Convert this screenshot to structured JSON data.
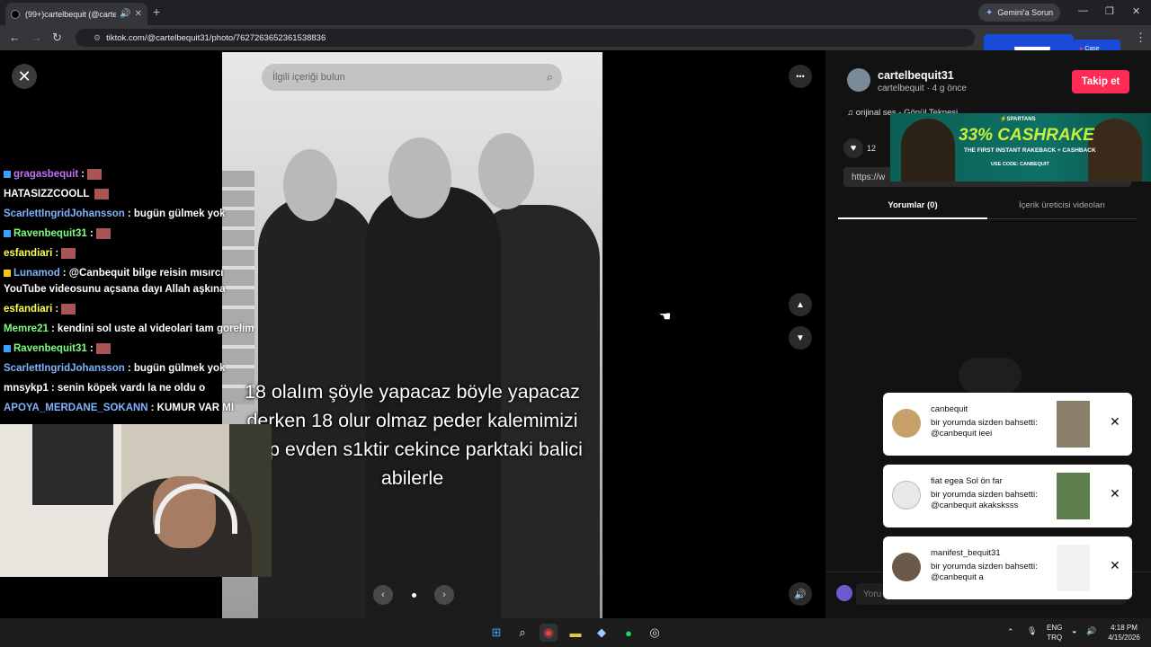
{
  "browser": {
    "tab_title": "(99+)cartelbequit (@carte",
    "tab_mute": "🔊",
    "tab_close": "✕",
    "new_tab": "+",
    "gemini_label": "Gemini'a Sorun",
    "window_minimize": "—",
    "window_restore": "❐",
    "window_close": "✕",
    "url": "tiktok.com/@cartelbequit31/photo/7627263652361538836",
    "ad_label": "Case"
  },
  "viewer": {
    "close": "✕",
    "search_placeholder": "İlgili içeriği bulun",
    "caption": "18 olalım şöyle yapacaz böyle yapacaz derken 18 olur olmaz peder kalemimizi kırıp evden s1ktir cekince parktaki balici abilerle",
    "more": "•••",
    "prev_photo": "‹",
    "next_photo": "›",
    "nav_up": "▲",
    "nav_down": "▼",
    "sound": "🔊"
  },
  "chat": [
    {
      "user": "gragasbequit",
      "color": "#c471ff",
      "text": "",
      "emote": true
    },
    {
      "user": "HATASIZZCOOLL",
      "color": "#ffffff",
      "text": "",
      "emote": true
    },
    {
      "user": "ScarlettIngridJohansson",
      "color": "#7fb3ff",
      "text": "bugün gülmek yok"
    },
    {
      "user": "Ravenbequit31",
      "color": "#7cff7c",
      "text": "",
      "emote": true
    },
    {
      "user": "esfandiari",
      "color": "#ffff55",
      "text": "",
      "emote": true
    },
    {
      "user": "Lunamod",
      "color": "#7fb3ff",
      "text": "@Canbequit bilge reisin mısırcı"
    },
    {
      "user": "",
      "color": "#ffffff",
      "text": "YouTube videosunu açsana dayı Allah aşkına"
    },
    {
      "user": "esfandiari",
      "color": "#ffff55",
      "text": "",
      "emote": true
    },
    {
      "user": "Memre21",
      "color": "#7cff7c",
      "text": "kendini sol uste al videolari tam gorelim"
    },
    {
      "user": "Ravenbequit31",
      "color": "#7cff7c",
      "text": "",
      "emote": true
    },
    {
      "user": "ScarlettIngridJohansson",
      "color": "#7fb3ff",
      "text": "bugün gülmek yok"
    },
    {
      "user": "mnsykp1",
      "color": "#ffffff",
      "text": "senin köpek vardı la ne oldu o"
    },
    {
      "user": "APOYA_MERDANE_SOKANN",
      "color": "#7fb3ff",
      "text": "KUMUR VAR MI"
    }
  ],
  "chat_sep": ":",
  "panel": {
    "username": "cartelbequit31",
    "subline": "cartelbequit · 4 g önce",
    "follow": "Takip et",
    "music": "♫  orijinal ses - Gönül Teknesi",
    "like_icon": "♥",
    "like_count": "12",
    "link": "https://w",
    "tab_comments": "Yorumlar (0)",
    "tab_creator": "İçerik üreticisi videoları",
    "comment_placeholder": "Yoru"
  },
  "banner": {
    "brand": "⚡SPARTANS",
    "headline": "33% CASHRAKE",
    "subline": "THE FIRST INSTANT RAKEBACK + CASHBACK",
    "code": "USE CODE: CANBEQUIT"
  },
  "toasts": [
    {
      "user": "canbequit",
      "msg": "bir yorumda sizden bahsetti: @canbequit ieei",
      "close": "✕"
    },
    {
      "user": "fiat egea Sol ön far",
      "msg": "bir yorumda sizden bahsetti: @canbequit akaksksss",
      "close": "✕"
    },
    {
      "user": "manifest_bequit31",
      "msg": "bir yorumda sizden bahsetti: @canbequit a",
      "close": "✕"
    }
  ],
  "taskbar": {
    "lang_top": "ENG",
    "lang_bottom": "TRQ",
    "time": "4:18 PM",
    "date": "4/15/2026"
  }
}
